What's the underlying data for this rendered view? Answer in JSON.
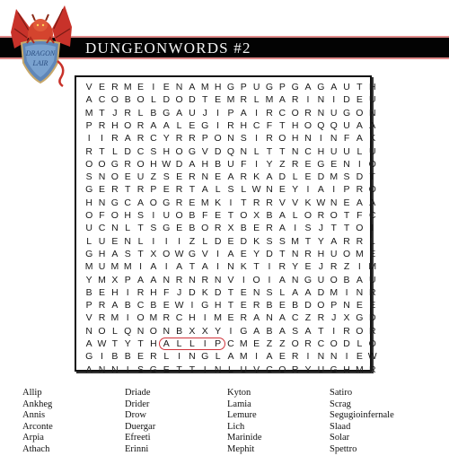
{
  "header": {
    "title": "DUNGEONWORDS #2",
    "logo_text": "DRAGON LAIR",
    "banner_color": "#030303",
    "banner_border_color": "#e08a8a"
  },
  "puzzle": {
    "rows": [
      "VERMEIENAMHGPUGPGAGAUTH",
      "ACOBOLDODTEMRLMARINIDEU",
      "MTJRLBGAUJIPAIRCORNUGON",
      "PRHORAALEGIRHCFTHOQQUAA",
      "IIRARCYRRPONSIROHNINFAK",
      "RTLDCSHOGVDQNLTTNCHUULU",
      "OOGROHWDAHBUFIYZREGENIO",
      "SNOEUZSERNEARKADLEDMSDT",
      "GERTRPERTALSLWNEYIAIPRO",
      "HNGCAOGREMKITRRVVKWNEAA",
      "OFOHSIUOBFETOXBALOROTFC",
      "UCNLTSGEBORXBERAISJTTOI",
      "LUENLIIIZLDEDKSSMTYARRL",
      "GHASTXOWGVIAEYDTNRHUOME",
      "MUMMIAIATAINKTIRYEJRZIM",
      "YMXPAANRNRNVIOIANGUOBAU",
      "BEHIRHFJDKDTENSLAADMINR",
      "PRABCBEWIGHTERBEBDOPNEE",
      "VRMIOMRCHIMERANACZRJXGD",
      "NOLQNONBXXYIGABASATIROR",
      "AWTYTHALLIPCMEZZORCODLO",
      "GIBBERLINGLAMIAERINNIEW",
      "ANNISGETTINLUVCORYUGHMR"
    ],
    "found_words": [
      {
        "word": "ALLIP",
        "row": 20,
        "col_start": 6,
        "col_end": 10,
        "direction": "horizontal"
      }
    ],
    "highlight_color": "#d0343c"
  },
  "wordlist": {
    "columns": [
      [
        "Allip",
        "Ankheg",
        "Annis",
        "Arconte",
        "Arpia",
        "Athach"
      ],
      [
        "Driade",
        "Drider",
        "Drow",
        "Duergar",
        "Efreeti",
        "Erinni"
      ],
      [
        "Kyton",
        "Lamia",
        "Lemure",
        "Lich",
        "Marinide",
        "Mephit"
      ],
      [
        "Satiro",
        "Scrag",
        "Segugioinfernale",
        "Slaad",
        "Solar",
        "Spettro"
      ]
    ]
  }
}
